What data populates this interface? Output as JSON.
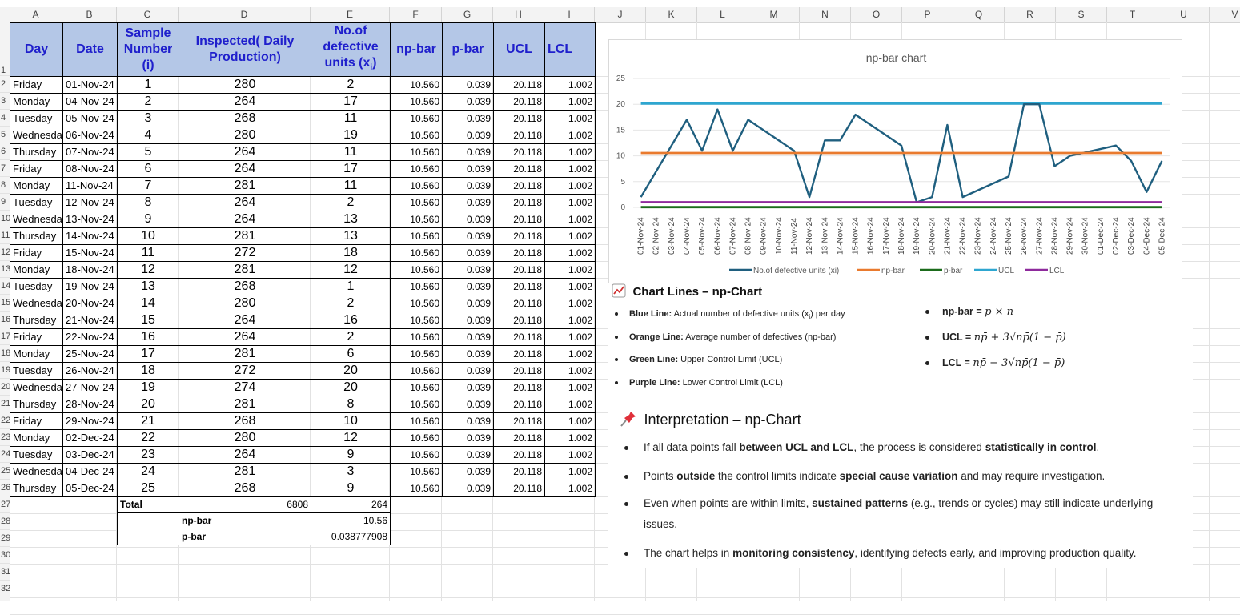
{
  "columns": [
    "A",
    "B",
    "C",
    "D",
    "E",
    "F",
    "G",
    "H",
    "I",
    "J",
    "K",
    "L",
    "M",
    "N",
    "O",
    "P",
    "Q",
    "R",
    "S",
    "T",
    "U",
    "V"
  ],
  "row_numbers": [
    "1",
    "2",
    "3",
    "4",
    "5",
    "6",
    "7",
    "8",
    "9",
    "10",
    "11",
    "12",
    "13",
    "14",
    "15",
    "16",
    "17",
    "18",
    "19",
    "20",
    "21",
    "22",
    "23",
    "24",
    "25",
    "26",
    "27",
    "28",
    "29",
    "30",
    "31",
    "32"
  ],
  "headers": {
    "day": "Day",
    "date": "Date",
    "sample": "Sample Number (i)",
    "inspected": "Inspected( Daily Production)",
    "defective_main": "No.of defective units (x",
    "defective_sub": "i",
    "defective_end": ")",
    "npbar": "np-bar",
    "pbar": "p-bar",
    "ucl": "UCL",
    "lcl": "LCL"
  },
  "rows": [
    {
      "day": "Friday",
      "date": "01-Nov-24",
      "n": "1",
      "insp": "280",
      "def": "2",
      "npbar": "10.560",
      "pbar": "0.039",
      "ucl": "20.118",
      "lcl": "1.002"
    },
    {
      "day": "Monday",
      "date": "04-Nov-24",
      "n": "2",
      "insp": "264",
      "def": "17",
      "npbar": "10.560",
      "pbar": "0.039",
      "ucl": "20.118",
      "lcl": "1.002"
    },
    {
      "day": "Tuesday",
      "date": "05-Nov-24",
      "n": "3",
      "insp": "268",
      "def": "11",
      "npbar": "10.560",
      "pbar": "0.039",
      "ucl": "20.118",
      "lcl": "1.002"
    },
    {
      "day": "Wednesda",
      "date": "06-Nov-24",
      "n": "4",
      "insp": "280",
      "def": "19",
      "npbar": "10.560",
      "pbar": "0.039",
      "ucl": "20.118",
      "lcl": "1.002"
    },
    {
      "day": "Thursday",
      "date": "07-Nov-24",
      "n": "5",
      "insp": "264",
      "def": "11",
      "npbar": "10.560",
      "pbar": "0.039",
      "ucl": "20.118",
      "lcl": "1.002"
    },
    {
      "day": "Friday",
      "date": "08-Nov-24",
      "n": "6",
      "insp": "264",
      "def": "17",
      "npbar": "10.560",
      "pbar": "0.039",
      "ucl": "20.118",
      "lcl": "1.002"
    },
    {
      "day": "Monday",
      "date": "11-Nov-24",
      "n": "7",
      "insp": "281",
      "def": "11",
      "npbar": "10.560",
      "pbar": "0.039",
      "ucl": "20.118",
      "lcl": "1.002"
    },
    {
      "day": "Tuesday",
      "date": "12-Nov-24",
      "n": "8",
      "insp": "264",
      "def": "2",
      "npbar": "10.560",
      "pbar": "0.039",
      "ucl": "20.118",
      "lcl": "1.002"
    },
    {
      "day": "Wednesda",
      "date": "13-Nov-24",
      "n": "9",
      "insp": "264",
      "def": "13",
      "npbar": "10.560",
      "pbar": "0.039",
      "ucl": "20.118",
      "lcl": "1.002"
    },
    {
      "day": "Thursday",
      "date": "14-Nov-24",
      "n": "10",
      "insp": "281",
      "def": "13",
      "npbar": "10.560",
      "pbar": "0.039",
      "ucl": "20.118",
      "lcl": "1.002"
    },
    {
      "day": "Friday",
      "date": "15-Nov-24",
      "n": "11",
      "insp": "272",
      "def": "18",
      "npbar": "10.560",
      "pbar": "0.039",
      "ucl": "20.118",
      "lcl": "1.002"
    },
    {
      "day": "Monday",
      "date": "18-Nov-24",
      "n": "12",
      "insp": "281",
      "def": "12",
      "npbar": "10.560",
      "pbar": "0.039",
      "ucl": "20.118",
      "lcl": "1.002"
    },
    {
      "day": "Tuesday",
      "date": "19-Nov-24",
      "n": "13",
      "insp": "268",
      "def": "1",
      "npbar": "10.560",
      "pbar": "0.039",
      "ucl": "20.118",
      "lcl": "1.002"
    },
    {
      "day": "Wednesda",
      "date": "20-Nov-24",
      "n": "14",
      "insp": "280",
      "def": "2",
      "npbar": "10.560",
      "pbar": "0.039",
      "ucl": "20.118",
      "lcl": "1.002"
    },
    {
      "day": "Thursday",
      "date": "21-Nov-24",
      "n": "15",
      "insp": "264",
      "def": "16",
      "npbar": "10.560",
      "pbar": "0.039",
      "ucl": "20.118",
      "lcl": "1.002"
    },
    {
      "day": "Friday",
      "date": "22-Nov-24",
      "n": "16",
      "insp": "264",
      "def": "2",
      "npbar": "10.560",
      "pbar": "0.039",
      "ucl": "20.118",
      "lcl": "1.002"
    },
    {
      "day": "Monday",
      "date": "25-Nov-24",
      "n": "17",
      "insp": "281",
      "def": "6",
      "npbar": "10.560",
      "pbar": "0.039",
      "ucl": "20.118",
      "lcl": "1.002"
    },
    {
      "day": "Tuesday",
      "date": "26-Nov-24",
      "n": "18",
      "insp": "272",
      "def": "20",
      "npbar": "10.560",
      "pbar": "0.039",
      "ucl": "20.118",
      "lcl": "1.002"
    },
    {
      "day": "Wednesda",
      "date": "27-Nov-24",
      "n": "19",
      "insp": "274",
      "def": "20",
      "npbar": "10.560",
      "pbar": "0.039",
      "ucl": "20.118",
      "lcl": "1.002"
    },
    {
      "day": "Thursday",
      "date": "28-Nov-24",
      "n": "20",
      "insp": "281",
      "def": "8",
      "npbar": "10.560",
      "pbar": "0.039",
      "ucl": "20.118",
      "lcl": "1.002"
    },
    {
      "day": "Friday",
      "date": "29-Nov-24",
      "n": "21",
      "insp": "268",
      "def": "10",
      "npbar": "10.560",
      "pbar": "0.039",
      "ucl": "20.118",
      "lcl": "1.002"
    },
    {
      "day": "Monday",
      "date": "02-Dec-24",
      "n": "22",
      "insp": "280",
      "def": "12",
      "npbar": "10.560",
      "pbar": "0.039",
      "ucl": "20.118",
      "lcl": "1.002"
    },
    {
      "day": "Tuesday",
      "date": "03-Dec-24",
      "n": "23",
      "insp": "264",
      "def": "9",
      "npbar": "10.560",
      "pbar": "0.039",
      "ucl": "20.118",
      "lcl": "1.002"
    },
    {
      "day": "Wednesda",
      "date": "04-Dec-24",
      "n": "24",
      "insp": "281",
      "def": "3",
      "npbar": "10.560",
      "pbar": "0.039",
      "ucl": "20.118",
      "lcl": "1.002"
    },
    {
      "day": "Thursday",
      "date": "05-Dec-24",
      "n": "25",
      "insp": "268",
      "def": "9",
      "npbar": "10.560",
      "pbar": "0.039",
      "ucl": "20.118",
      "lcl": "1.002"
    }
  ],
  "totals": {
    "total_label": "Total",
    "total_inspected": "6808",
    "total_defective": "264",
    "npbar_label": "np-bar",
    "npbar_value": "10.56",
    "pbar_label": "p-bar",
    "pbar_value": "0.038777908"
  },
  "chart_data": {
    "type": "line",
    "title": "np-bar chart",
    "categories": [
      "01-Nov-24",
      "02-Nov-24",
      "03-Nov-24",
      "04-Nov-24",
      "05-Nov-24",
      "06-Nov-24",
      "07-Nov-24",
      "08-Nov-24",
      "09-Nov-24",
      "10-Nov-24",
      "11-Nov-24",
      "12-Nov-24",
      "13-Nov-24",
      "14-Nov-24",
      "15-Nov-24",
      "16-Nov-24",
      "17-Nov-24",
      "18-Nov-24",
      "19-Nov-24",
      "20-Nov-24",
      "21-Nov-24",
      "22-Nov-24",
      "23-Nov-24",
      "24-Nov-24",
      "25-Nov-24",
      "26-Nov-24",
      "27-Nov-24",
      "28-Nov-24",
      "29-Nov-24",
      "30-Nov-24",
      "01-Dec-24",
      "02-Dec-24",
      "03-Dec-24",
      "04-Dec-24",
      "05-Dec-24"
    ],
    "x_dates": [
      "01-Nov-24",
      "04-Nov-24",
      "05-Nov-24",
      "06-Nov-24",
      "07-Nov-24",
      "08-Nov-24",
      "11-Nov-24",
      "12-Nov-24",
      "13-Nov-24",
      "14-Nov-24",
      "15-Nov-24",
      "18-Nov-24",
      "19-Nov-24",
      "20-Nov-24",
      "21-Nov-24",
      "22-Nov-24",
      "25-Nov-24",
      "26-Nov-24",
      "27-Nov-24",
      "28-Nov-24",
      "29-Nov-24",
      "02-Dec-24",
      "03-Dec-24",
      "04-Dec-24",
      "05-Dec-24"
    ],
    "series": [
      {
        "name": "No.of defective units (xi)",
        "color": "#1f5f7f",
        "values": [
          2,
          17,
          11,
          19,
          11,
          17,
          11,
          2,
          13,
          13,
          18,
          12,
          1,
          2,
          16,
          2,
          6,
          20,
          20,
          8,
          10,
          12,
          9,
          3,
          9
        ]
      },
      {
        "name": "np-bar",
        "color": "#e97a2e",
        "values": [
          10.56,
          10.56,
          10.56,
          10.56,
          10.56,
          10.56,
          10.56,
          10.56,
          10.56,
          10.56,
          10.56,
          10.56,
          10.56,
          10.56,
          10.56,
          10.56,
          10.56,
          10.56,
          10.56,
          10.56,
          10.56,
          10.56,
          10.56,
          10.56,
          10.56
        ]
      },
      {
        "name": "p-bar",
        "color": "#1b6b1b",
        "values": [
          0.039,
          0.039,
          0.039,
          0.039,
          0.039,
          0.039,
          0.039,
          0.039,
          0.039,
          0.039,
          0.039,
          0.039,
          0.039,
          0.039,
          0.039,
          0.039,
          0.039,
          0.039,
          0.039,
          0.039,
          0.039,
          0.039,
          0.039,
          0.039,
          0.039
        ]
      },
      {
        "name": "UCL",
        "color": "#2ea6d0",
        "values": [
          20.118,
          20.118,
          20.118,
          20.118,
          20.118,
          20.118,
          20.118,
          20.118,
          20.118,
          20.118,
          20.118,
          20.118,
          20.118,
          20.118,
          20.118,
          20.118,
          20.118,
          20.118,
          20.118,
          20.118,
          20.118,
          20.118,
          20.118,
          20.118,
          20.118
        ]
      },
      {
        "name": "LCL",
        "color": "#8e2a9c",
        "values": [
          1.002,
          1.002,
          1.002,
          1.002,
          1.002,
          1.002,
          1.002,
          1.002,
          1.002,
          1.002,
          1.002,
          1.002,
          1.002,
          1.002,
          1.002,
          1.002,
          1.002,
          1.002,
          1.002,
          1.002,
          1.002,
          1.002,
          1.002,
          1.002,
          1.002
        ]
      }
    ],
    "y_ticks": [
      "0",
      "5",
      "10",
      "15",
      "20",
      "25"
    ],
    "ylim": [
      0,
      25
    ],
    "grid": true,
    "legend_position": "bottom"
  },
  "notes": {
    "lines_title": "Chart Lines – np-Chart",
    "lines": [
      {
        "label": "Blue Line:",
        "text": " Actual number of defective units (x",
        "sub": "i",
        "end": ") per day"
      },
      {
        "label": "Orange Line:",
        "text": " Average number of defectives (np-bar)",
        "sub": "",
        "end": ""
      },
      {
        "label": "Green Line:",
        "text": " Upper Control Limit (UCL)",
        "sub": "",
        "end": ""
      },
      {
        "label": "Purple Line:",
        "text": " Lower Control Limit (LCL)",
        "sub": "",
        "end": ""
      }
    ],
    "formulas": [
      {
        "label": "np-bar = ",
        "expr": "p̄ × n"
      },
      {
        "label": "UCL = ",
        "expr": "np̄ + 3√np̄(1 − p̄)"
      },
      {
        "label": "LCL = ",
        "expr": "np̄ − 3√np̄(1 − p̄)"
      }
    ],
    "interp_title": "Interpretation – np-Chart",
    "interp": [
      {
        "pre": "If all data points fall ",
        "b1": "between UCL and LCL",
        "mid": ", the process is considered ",
        "b2": "statistically in control",
        "post": "."
      },
      {
        "pre": "Points ",
        "b1": "outside",
        "mid": " the control limits indicate ",
        "b2": "special cause variation",
        "post": " and may require investigation."
      },
      {
        "pre": "Even when points are within limits, ",
        "b1": "sustained patterns",
        "mid": " (e.g., trends or cycles) may still indicate underlying issues.",
        "b2": "",
        "post": ""
      },
      {
        "pre": "The chart helps in ",
        "b1": "monitoring consistency",
        "mid": ", identifying defects early, and improving production quality.",
        "b2": "",
        "post": ""
      }
    ]
  },
  "icons": {
    "chart_icon": "chart-increasing-icon",
    "pin_icon": "pushpin-icon"
  }
}
